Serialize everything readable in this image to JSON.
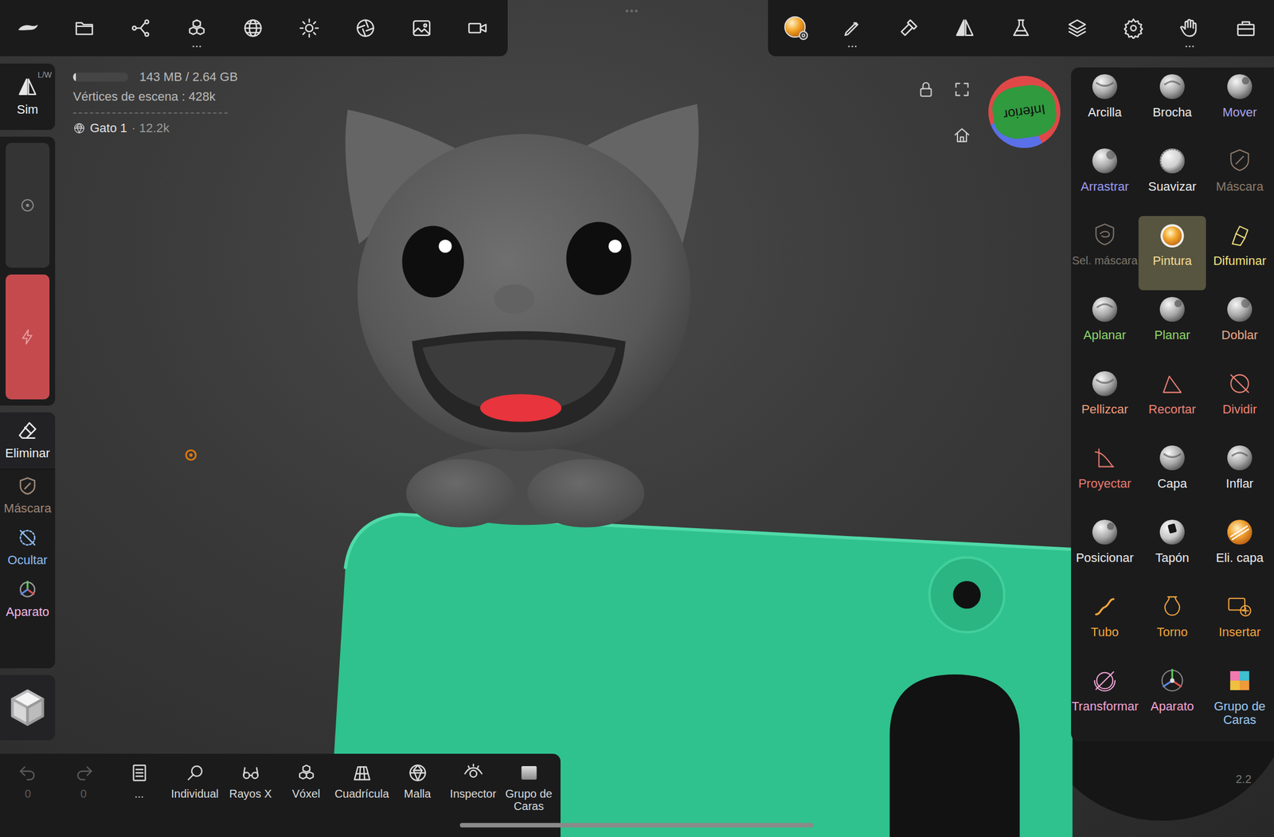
{
  "top_handle": "•••",
  "stats": {
    "memory": "143 MB / 2.64 GB",
    "memory_level": 0.05,
    "vertices": "Vértices de escena : 428k",
    "object_name": "Gato 1",
    "object_count": "· 12.2k"
  },
  "symmetry": {
    "label": "Sim",
    "mode": "L/W"
  },
  "sliders": [
    {
      "level": 0
    },
    {
      "level": 1
    }
  ],
  "left_tools": [
    {
      "label": "Eliminar",
      "color": "#f0f0f0"
    },
    {
      "label": "Máscara",
      "color": "#9c8676"
    },
    {
      "label": "Ocultar",
      "color": "#8fbdf2"
    },
    {
      "label": "Aparato",
      "color": "#f2b8e6"
    }
  ],
  "view_cube": {
    "label": "Inferior"
  },
  "tools": [
    {
      "label": "Arcilla",
      "color": "#ececec",
      "selected": false
    },
    {
      "label": "Brocha",
      "color": "#ececec",
      "selected": false
    },
    {
      "label": "Mover",
      "color": "#a9a4f2",
      "selected": false
    },
    {
      "label": "Arrastrar",
      "color": "#9d9cf2",
      "selected": false
    },
    {
      "label": "Suavizar",
      "color": "#ececec",
      "selected": false
    },
    {
      "label": "Máscara",
      "color": "#8c7b6c",
      "selected": false
    },
    {
      "label": "Sel. máscara",
      "color": "#7f7569",
      "selected": false
    },
    {
      "label": "Pintura",
      "color": "#f4dc96",
      "selected": true
    },
    {
      "label": "Difuminar",
      "color": "#f2e27c",
      "selected": false
    },
    {
      "label": "Aplanar",
      "color": "#8fd66c",
      "selected": false
    },
    {
      "label": "Planar",
      "color": "#8fd66c",
      "selected": false
    },
    {
      "label": "Doblar",
      "color": "#f2a884",
      "selected": false
    },
    {
      "label": "Pellizcar",
      "color": "#f29c7a",
      "selected": false
    },
    {
      "label": "Recortar",
      "color": "#ee8474",
      "selected": false
    },
    {
      "label": "Dividir",
      "color": "#ee8474",
      "selected": false
    },
    {
      "label": "Proyectar",
      "color": "#ea7a70",
      "selected": false
    },
    {
      "label": "Capa",
      "color": "#ececec",
      "selected": false
    },
    {
      "label": "Inflar",
      "color": "#ececec",
      "selected": false
    },
    {
      "label": "Posicionar",
      "color": "#ececec",
      "selected": false
    },
    {
      "label": "Tapón",
      "color": "#ececec",
      "selected": false
    },
    {
      "label": "Eli. capa",
      "color": "#ececec",
      "selected": false
    },
    {
      "label": "Tubo",
      "color": "#f2a43c",
      "selected": false
    },
    {
      "label": "Torno",
      "color": "#f2a43c",
      "selected": false
    },
    {
      "label": "Insertar",
      "color": "#f2a43c",
      "selected": false
    },
    {
      "label": "Transformar",
      "color": "#f2a4d4",
      "selected": false
    },
    {
      "label": "Aparato",
      "color": "#f2a4d4",
      "selected": false
    },
    {
      "label": "Grupo de Caras",
      "color": "#9ccaf2",
      "selected": false
    }
  ],
  "bottom_bar": [
    {
      "label": "0",
      "disabled": true
    },
    {
      "label": "0",
      "disabled": true
    },
    {
      "label": "...",
      "disabled": false
    },
    {
      "label": "Individual",
      "disabled": false
    },
    {
      "label": "Rayos X",
      "disabled": false
    },
    {
      "label": "Vóxel",
      "disabled": false
    },
    {
      "label": "Cuadrícula",
      "disabled": false
    },
    {
      "label": "Malla",
      "disabled": false
    },
    {
      "label": "Inspector",
      "disabled": false
    },
    {
      "label": "Grupo de Caras",
      "disabled": false
    }
  ],
  "version": "2.2"
}
